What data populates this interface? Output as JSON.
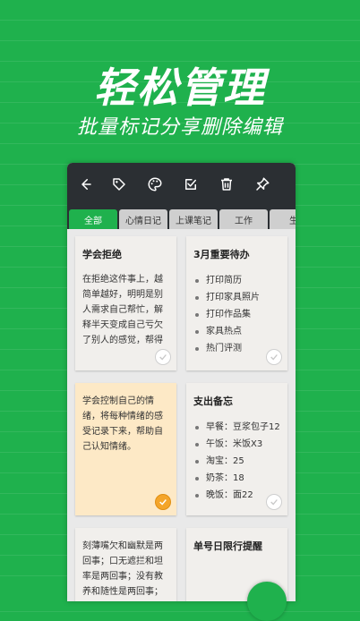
{
  "headline": "轻松管理",
  "subheadline": "批量标记分享删除编辑",
  "toolbar": {
    "icons": [
      "back-arrow-icon",
      "tag-icon",
      "palette-icon",
      "checkbox-icon",
      "trash-icon",
      "pin-icon"
    ]
  },
  "tabs": [
    {
      "label": "全部",
      "active": true
    },
    {
      "label": "心情日记",
      "active": false
    },
    {
      "label": "上课笔记",
      "active": false
    },
    {
      "label": "工作",
      "active": false
    },
    {
      "label": "生",
      "active": false
    }
  ],
  "cards": [
    {
      "title": "学会拒绝",
      "body": "在拒绝这件事上，越简单越好，明明是别人需求自己帮忙，解释半天变成自己亏欠了别人的感觉，帮得上，想帮就帮，帮不上，就拒绝",
      "checked": false
    },
    {
      "title": "3月重要待办",
      "items": [
        "打印简历",
        "打印家具照片",
        "打印作品集",
        "家具热点",
        "热门评测"
      ],
      "checked": false
    },
    {
      "title": "",
      "body": "学会控制自己的情绪，将每种情绪的感受记录下来，帮助自己认知情绪。",
      "checked": true
    },
    {
      "title": "支出备忘",
      "items": [
        "早餐：豆浆包子12",
        "午饭：米饭X3",
        "淘宝：25",
        "奶茶：18",
        "晚饭：面22"
      ],
      "checked": false
    },
    {
      "title": "",
      "body": "刻薄嘴欠和幽默是两回事；口无遮拦和坦率是两回事；没有教养和随性是两回事；轻重不分"
    },
    {
      "title": "单号日限行提醒"
    }
  ],
  "colors": {
    "background": "#1fb14d",
    "toolbar": "#2b2f33",
    "card": "#f1efec",
    "card_highlight": "#fde9c6",
    "check_orange": "#f4a52a"
  }
}
